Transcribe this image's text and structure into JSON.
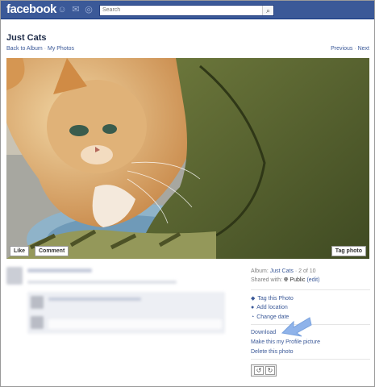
{
  "topbar": {
    "logo": "facebook",
    "search_placeholder": "Search"
  },
  "album": {
    "title": "Just Cats"
  },
  "crumbs": {
    "back": "Back to Album",
    "sep": " · ",
    "mine": "My Photos"
  },
  "nav": {
    "previous": "Previous",
    "sep": " · ",
    "next": "Next"
  },
  "photo_buttons": {
    "like": "Like",
    "comment": "Comment",
    "tag": "Tag photo"
  },
  "meta": {
    "album_label": "Album: ",
    "album_name": "Just Cats",
    "position": " · 2 of 10",
    "shared_label": "Shared with: ",
    "privacy": "Public",
    "edit": "(edit)"
  },
  "actions": {
    "tag_photo": "Tag this Photo",
    "add_location": "Add location",
    "change_date": "Change date",
    "download": "Download",
    "make_profile": "Make this my Profile picture",
    "delete_photo": "Delete this photo"
  },
  "colors": {
    "brand": "#3b5998",
    "link": "#3b5998",
    "arrow": "#8fb3ea"
  }
}
